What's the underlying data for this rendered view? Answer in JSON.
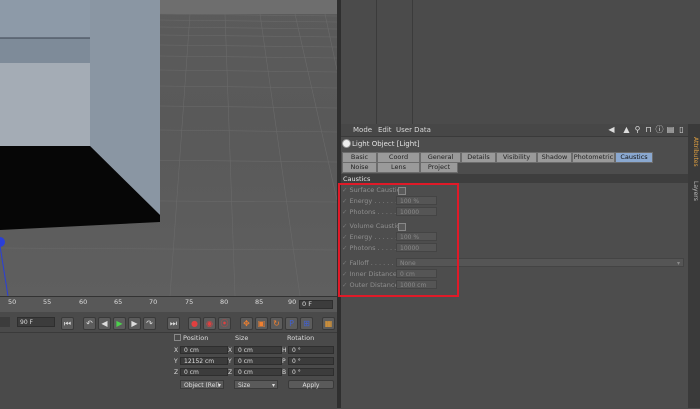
{
  "attributes": {
    "menu": [
      "Mode",
      "Edit",
      "User Data"
    ],
    "object_title": "Light Object [Light]",
    "tabs_row1": [
      "Basic",
      "Coord",
      "General",
      "Details",
      "Visibility",
      "Shadow",
      "Photometric",
      "Caustics"
    ],
    "tabs_row2": [
      "Noise",
      "Lens",
      "Project"
    ],
    "active_tab": "Caustics",
    "section": "Caustics",
    "params": {
      "surface_caustics": "Surface Caustics",
      "energy1_label": "Energy . . . . . . . .",
      "energy1_value": "100 %",
      "photons1_label": "Photons . . . . . .",
      "photons1_value": "10000",
      "volume_caustics": "Volume Caustics",
      "energy2_label": "Energy . . . . . . . .",
      "energy2_value": "100 %",
      "photons2_label": "Photons . . . . . .",
      "photons2_value": "10000",
      "falloff_label": "Falloff . . . . . . . . .",
      "falloff_value": "None",
      "inner_label": "Inner Distance .",
      "inner_value": "0 cm",
      "outer_label": "Outer Distance",
      "outer_value": "1000 cm"
    },
    "side_tabs": [
      "Attributes",
      "Layers"
    ],
    "highlight_color": "#e01a28"
  },
  "timeline": {
    "ticks": [
      "50",
      "55",
      "60",
      "65",
      "70",
      "75",
      "80",
      "85",
      "90"
    ],
    "frame_end": "0 F",
    "frame_field": "90 F"
  },
  "coordinates": {
    "headers": [
      "Position",
      "Size",
      "Rotation"
    ],
    "rows": [
      {
        "axis": "X",
        "pos": "0 cm",
        "size_axis": "X",
        "size": "0 cm",
        "rot_axis": "H",
        "rot": "0 °"
      },
      {
        "axis": "Y",
        "pos": "12152 cm",
        "size_axis": "Y",
        "size": "0 cm",
        "rot_axis": "P",
        "rot": "0 °"
      },
      {
        "axis": "Z",
        "pos": "0 cm",
        "size_axis": "Z",
        "size": "0 cm",
        "rot_axis": "B",
        "rot": "0 °"
      }
    ],
    "mode_dropdown": "Object (Rel)",
    "size_dropdown": "Size",
    "apply_label": "Apply"
  }
}
